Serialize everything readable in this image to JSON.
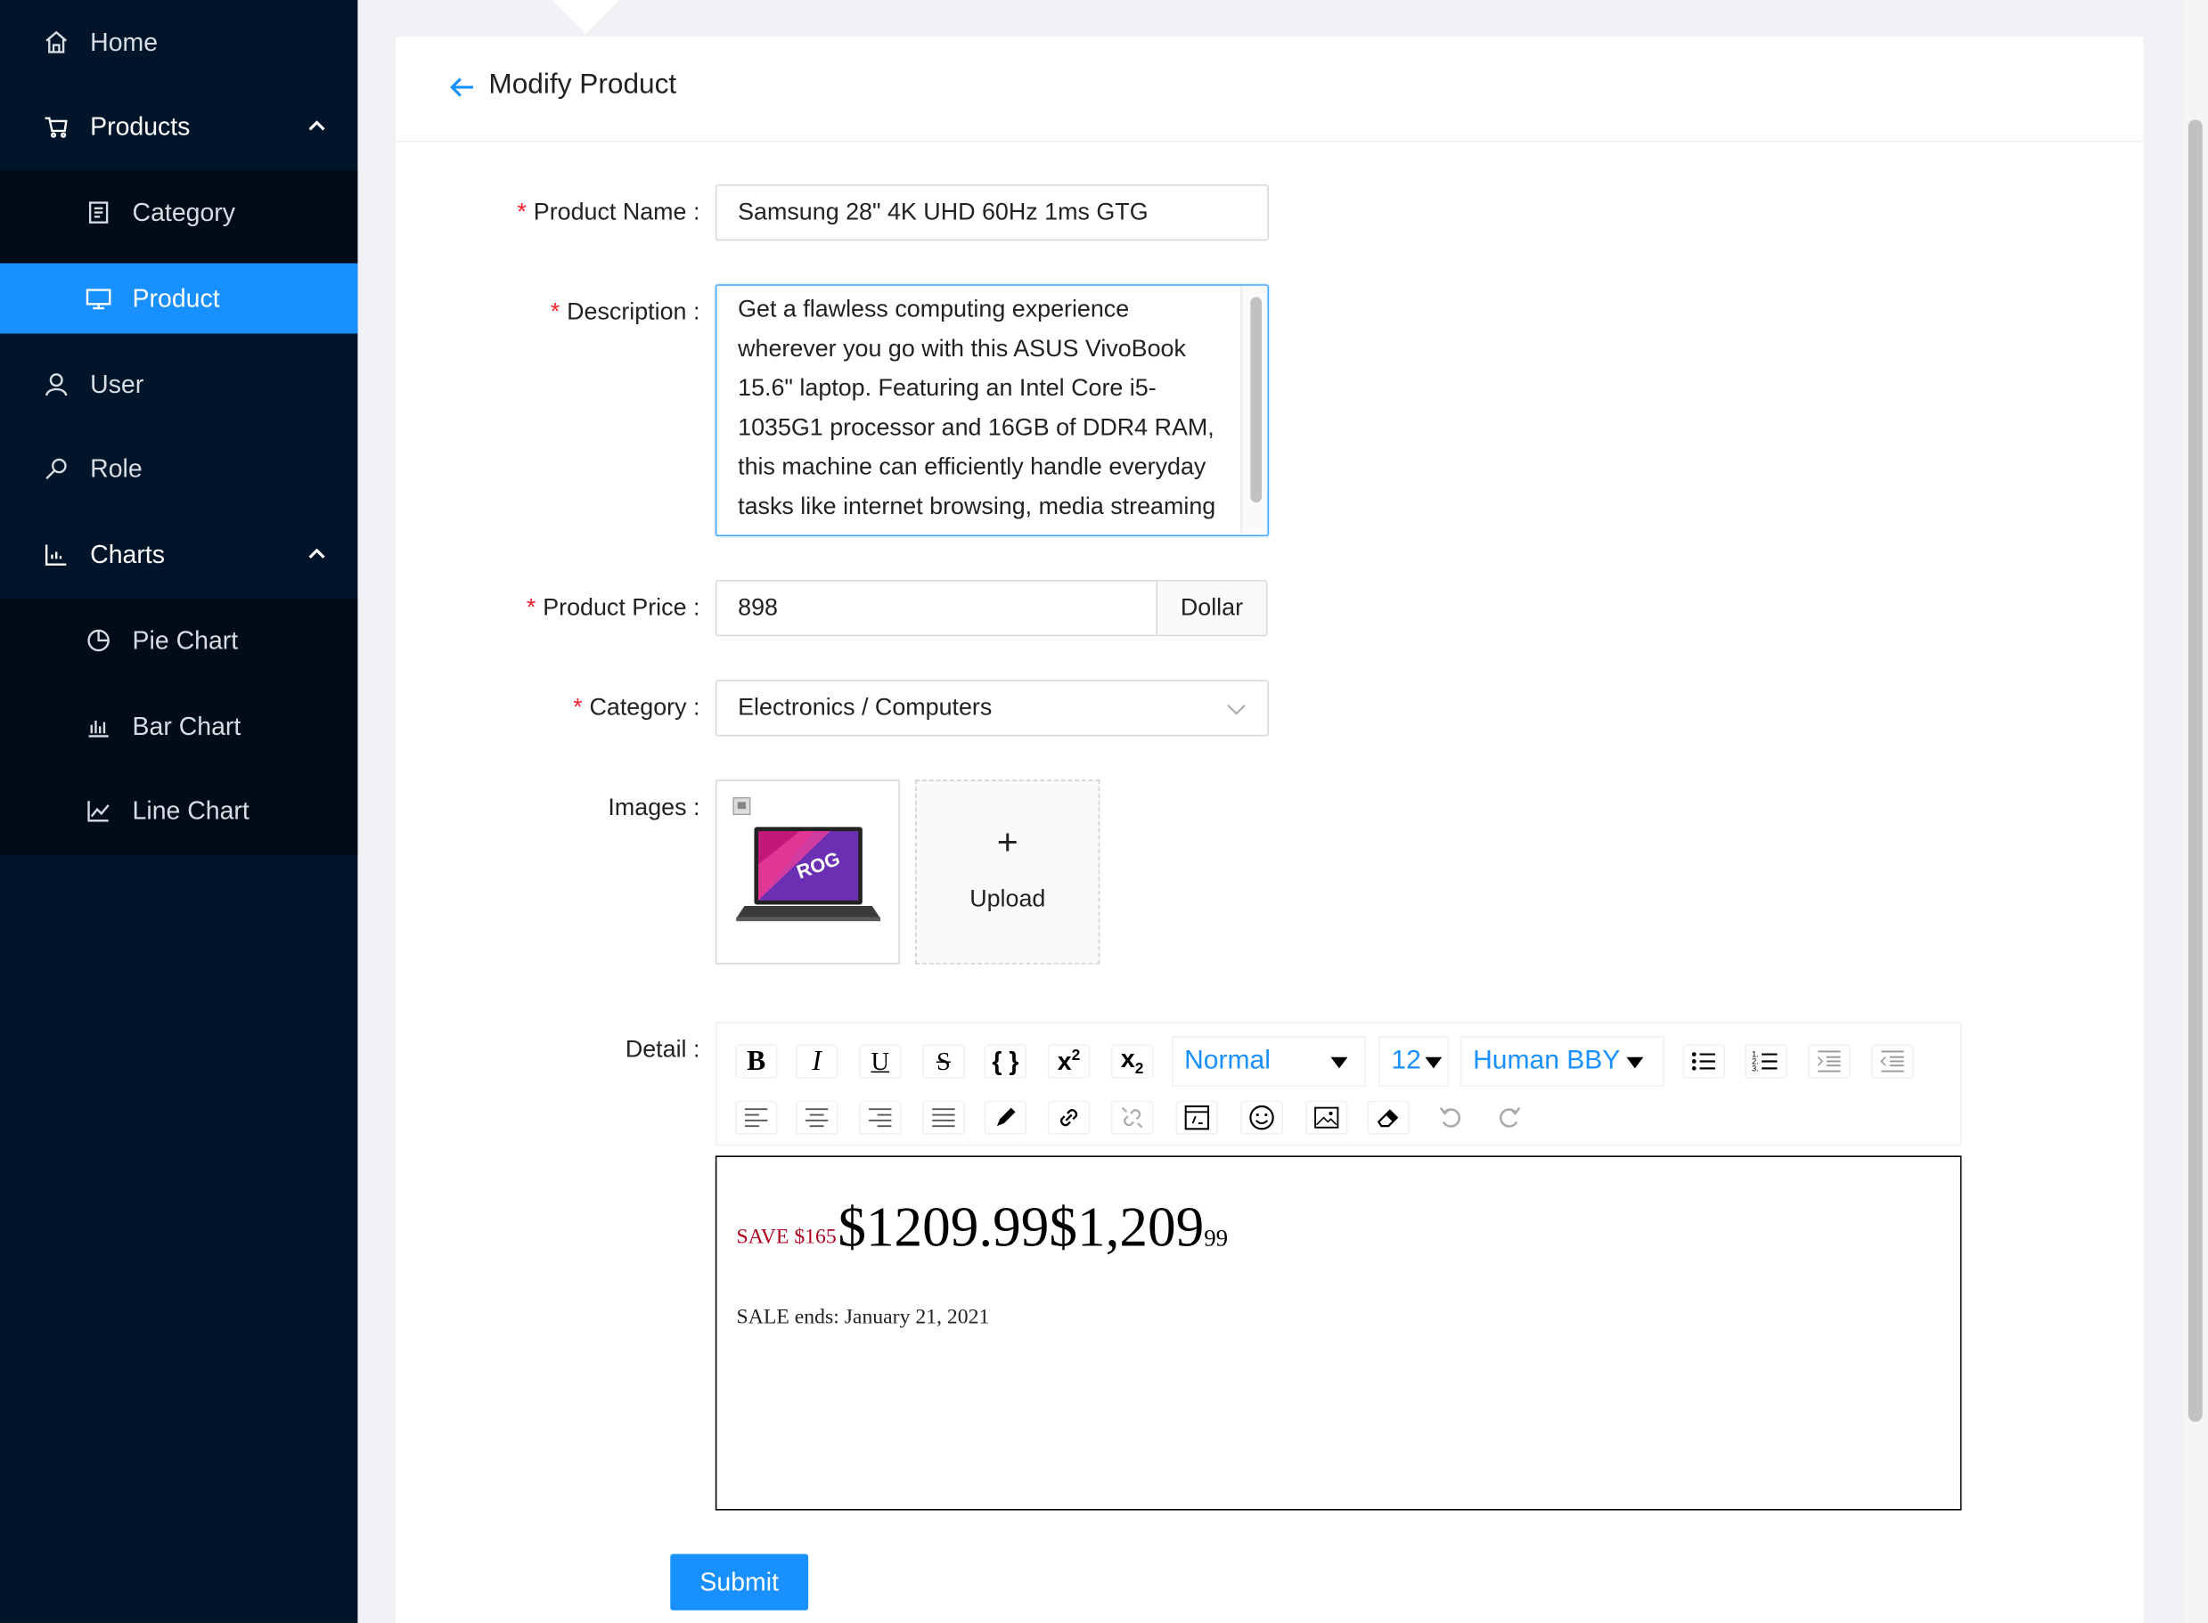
{
  "sidebar": {
    "items": [
      {
        "label": "Home",
        "icon": "home-icon"
      },
      {
        "label": "Products",
        "icon": "cart-icon",
        "expanded": true,
        "children": [
          {
            "label": "Category",
            "icon": "list-icon"
          },
          {
            "label": "Product",
            "icon": "monitor-icon",
            "selected": true
          }
        ]
      },
      {
        "label": "User",
        "icon": "user-icon"
      },
      {
        "label": "Role",
        "icon": "key-icon"
      },
      {
        "label": "Charts",
        "icon": "chart-icon",
        "expanded": true,
        "children": [
          {
            "label": "Pie Chart",
            "icon": "pie-chart-icon"
          },
          {
            "label": "Bar Chart",
            "icon": "bar-chart-icon"
          },
          {
            "label": "Line Chart",
            "icon": "line-chart-icon"
          }
        ]
      }
    ]
  },
  "header": {
    "title": "Modify Product"
  },
  "form": {
    "product_name": {
      "label": "Product Name",
      "value": "Samsung 28\" 4K UHD 60Hz 1ms GTG"
    },
    "description": {
      "label": "Description",
      "value": "Get a flawless computing experience wherever you go with this ASUS VivoBook 15.6\" laptop. Featuring an Intel Core i5-1035G1 processor and 16GB of DDR4 RAM, this machine can efficiently handle everyday tasks like internet browsing, media streaming and"
    },
    "price": {
      "label": "Product Price",
      "value": "898",
      "addon": "Dollar"
    },
    "category": {
      "label": "Category",
      "value": "Electronics / Computers"
    },
    "images": {
      "label": "Images",
      "upload_label": "Upload",
      "plus": "+"
    },
    "detail": {
      "label": "Detail",
      "toolbar": {
        "block_type": "Normal",
        "font_size": "12",
        "font_family": "Human BBY"
      },
      "content": {
        "save_text": "SAVE $165",
        "price_a": "$1209.99",
        "price_b": "$1,209",
        "price_cents": "99",
        "sale_text": "SALE ends: January 21, 2021"
      }
    },
    "submit_label": "Submit"
  },
  "colors": {
    "sidebar_bg": "#001529",
    "accent": "#1890ff",
    "required": "#f5222d",
    "save_red": "#b00020"
  }
}
